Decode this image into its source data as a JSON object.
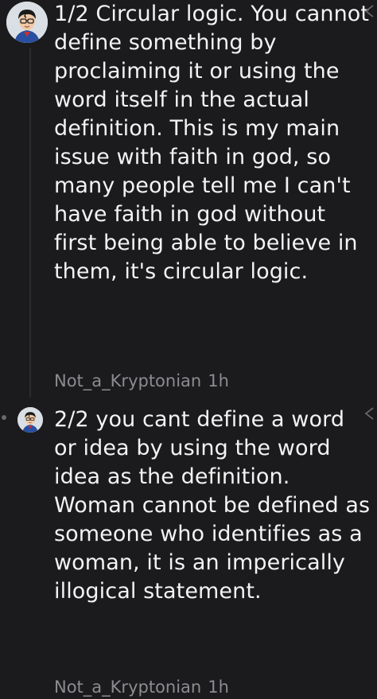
{
  "comments": [
    {
      "text": "1/2 Circular logic. You cannot define something by proclaiming it or using the word itself in the actual definition. This is my main issue with faith in god, so many people tell me I can't have faith in god without first being able to believe in them, it's circular logic.",
      "author": "Not_a_Kryptonian",
      "time": "1h",
      "avatar_icon": "superhero-avatar-icon",
      "collapse_icon": "chevron-left-icon"
    },
    {
      "text": "2/2 you cant define a word or idea by using the word idea as the definition. Woman cannot be defined as someone who identifies as a woman, it is an imperically illogical statement.",
      "author": "Not_a_Kryptonian",
      "time": "1h",
      "avatar_icon": "superhero-avatar-icon",
      "collapse_icon": "chevron-left-icon"
    }
  ],
  "colors": {
    "background": "#1b1b1d",
    "text": "#f3f3f3",
    "meta": "#8c8c90"
  }
}
